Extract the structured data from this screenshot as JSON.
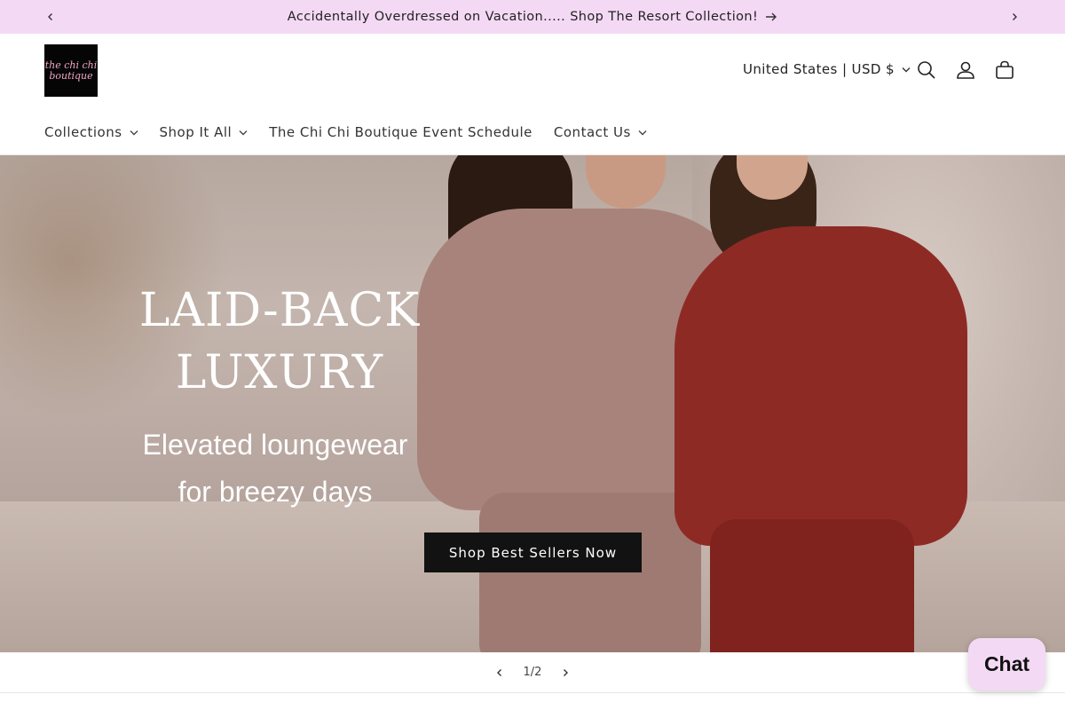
{
  "announcement": {
    "text": "Accidentally Overdressed on Vacation..... Shop The Resort Collection!",
    "icons": {
      "prev": "chevron-left-icon",
      "next": "chevron-right-icon",
      "arrow": "arrow-right-icon"
    }
  },
  "header": {
    "logo_lines": [
      "the chi chi",
      "boutique"
    ],
    "country_selector": "United States | USD $",
    "icons": [
      "search-icon",
      "account-icon",
      "cart-icon"
    ]
  },
  "nav": {
    "items": [
      {
        "label": "Collections",
        "has_dropdown": true
      },
      {
        "label": "Shop It All",
        "has_dropdown": true
      },
      {
        "label": "The Chi Chi Boutique Event Schedule",
        "has_dropdown": false
      },
      {
        "label": "Contact Us",
        "has_dropdown": true
      }
    ]
  },
  "hero": {
    "title_line1": "LAID-BACK",
    "title_line2": "LUXURY",
    "subtitle_line1": "Elevated loungewear",
    "subtitle_line2": "for breezy days",
    "button_label": "Shop Best Sellers Now"
  },
  "slider": {
    "counter": "1/2",
    "current": 1,
    "total": 2
  },
  "chat": {
    "label": "Chat"
  },
  "colors": {
    "announcement_bg": "#f4d9f4",
    "button_bg": "#121212",
    "logo_text": "#f2a6c8"
  }
}
